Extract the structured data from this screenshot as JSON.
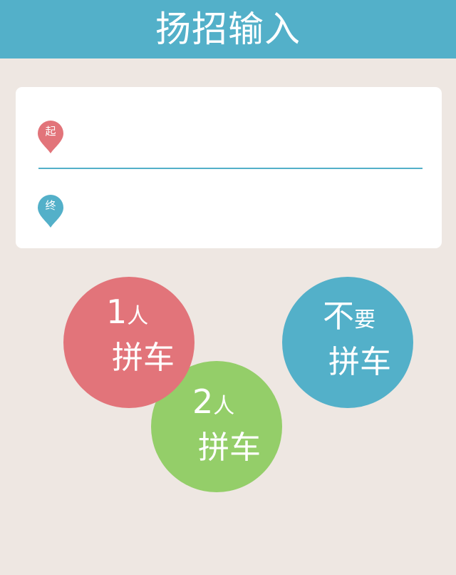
{
  "header": {
    "title": "扬招输入"
  },
  "location_card": {
    "start": {
      "pin_label": "起",
      "pin_color": "#E2747A",
      "value": "",
      "placeholder": ""
    },
    "end": {
      "pin_label": "终",
      "pin_color": "#53B0C9",
      "value": "",
      "placeholder": ""
    },
    "divider_color": "#53B0C9"
  },
  "options": {
    "one_person": {
      "main": "1",
      "sub": "人",
      "label": "拼车",
      "color": "#E2747A"
    },
    "two_person": {
      "main": "2",
      "sub": "人",
      "label": "拼车",
      "color": "#94CE69"
    },
    "no_carpool": {
      "main": "不",
      "sub": "要",
      "label": "拼车",
      "color": "#53B0C9"
    }
  },
  "colors": {
    "header_bg": "#53B0C9",
    "page_bg": "#EEE7E2",
    "card_bg": "#FFFFFF"
  }
}
